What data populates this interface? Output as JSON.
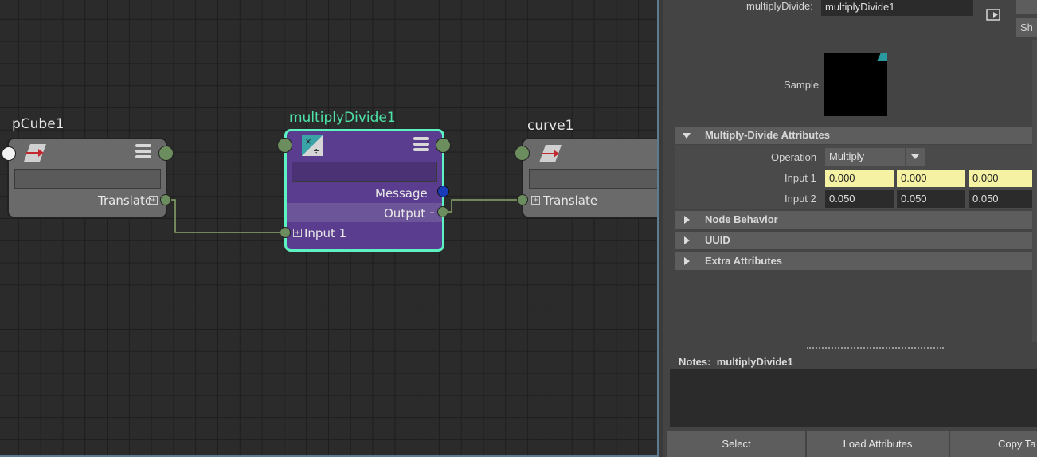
{
  "graph": {
    "nodes": {
      "pcube": {
        "title": "pCube1",
        "plug_label": "Translate"
      },
      "md": {
        "title": "multiplyDivide1",
        "message_label": "Message",
        "output_label": "Output",
        "input_label": "Input 1"
      },
      "curve": {
        "title": "curve1",
        "plug_label": "Translate"
      }
    },
    "colors": {
      "md_title": "#4de3a8",
      "md_body": "#5a3d8e",
      "md_border": "#5cf2c1",
      "connection": "#8aa86a"
    }
  },
  "attribute_editor": {
    "node_label": "multiplyDivide:",
    "node_name": "multiplyDivide1",
    "side_button": "Sh",
    "sample_label": "Sample",
    "sections": {
      "md_attributes": "Multiply-Divide Attributes",
      "node_behavior": "Node Behavior",
      "uuid": "UUID",
      "extra": "Extra Attributes"
    },
    "operation": {
      "label": "Operation",
      "value": "Multiply"
    },
    "input1": {
      "label": "Input 1",
      "values": [
        "0.000",
        "0.000",
        "0.000"
      ]
    },
    "input2": {
      "label": "Input 2",
      "values": [
        "0.050",
        "0.050",
        "0.050"
      ]
    },
    "notes": {
      "label": "Notes:",
      "node": "multiplyDivide1"
    },
    "buttons": {
      "select": "Select",
      "load": "Load Attributes",
      "copy": "Copy Ta"
    }
  }
}
